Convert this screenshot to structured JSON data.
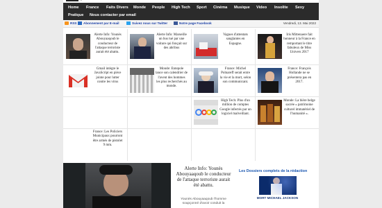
{
  "nav": {
    "row1": [
      "Home",
      "France",
      "Faits Divers",
      "Monde",
      "People",
      "High Tech",
      "Sport",
      "Cinéma",
      "Musique",
      "Video",
      "Insolite",
      "Sexy"
    ],
    "row2": [
      "Pratique",
      "Nous contacter par email"
    ]
  },
  "infobar": {
    "rss": "RSS",
    "email": "Abonnement par E-mail",
    "twitter": "Suivez nous sur Twitter",
    "facebook": "Notre page Facebook",
    "date": "Vendredi, 13. Mai 2022"
  },
  "articles": [
    "Alerte Info: Younès Abouyaaqoub le conducteur de l'attaque terroriste aurait été abattu.",
    "Alerte Info: Marseille un bus tué par une voiture qui fonçait sur des abribus",
    "Vagues d'attentats sanglantes en Espagne.",
    "Iris Mittenaere fait honneur à la France en remportant le titre fabuleux de Miss Univers 2017",
    "Gmail intègre le JavaScript en pièce jointe pour lutter contre les virus",
    "Monde: Entepole lance son calendrier de l'avent des hommes les plus recherchés au monde.",
    "France: Michel Polnareff serait entre la vie et la mort, selon son communicant.",
    "France: François Hollande ne se présentera pas en 2017.",
    "High Tech: Plus d'un million de comptes Google infectés par un logiciel malveillant.",
    "Monde: La bière belge sacrée « patrimoine culturel immatériel de l'humanité ».",
    "France: Les Policiers Municipaux pourront être armés de pistolet 9 mm."
  ],
  "feature": {
    "title": "Alerte Info: Younès Abouyaaqoub le conducteur de l'attaque terroriste aurait été abattu.",
    "subtitle": "Younès Abouyaaqoub l'homme soupçonné d'avoir conduit la"
  },
  "dossiers": {
    "title": "Les Dossiers complets de la rédaction",
    "caption": "MORT MICHAEL JACKSON"
  },
  "colors": {
    "nav_bg": "#2b2b2b",
    "link_blue": "#1a3fa6",
    "page_bg": "#ebebeb"
  }
}
